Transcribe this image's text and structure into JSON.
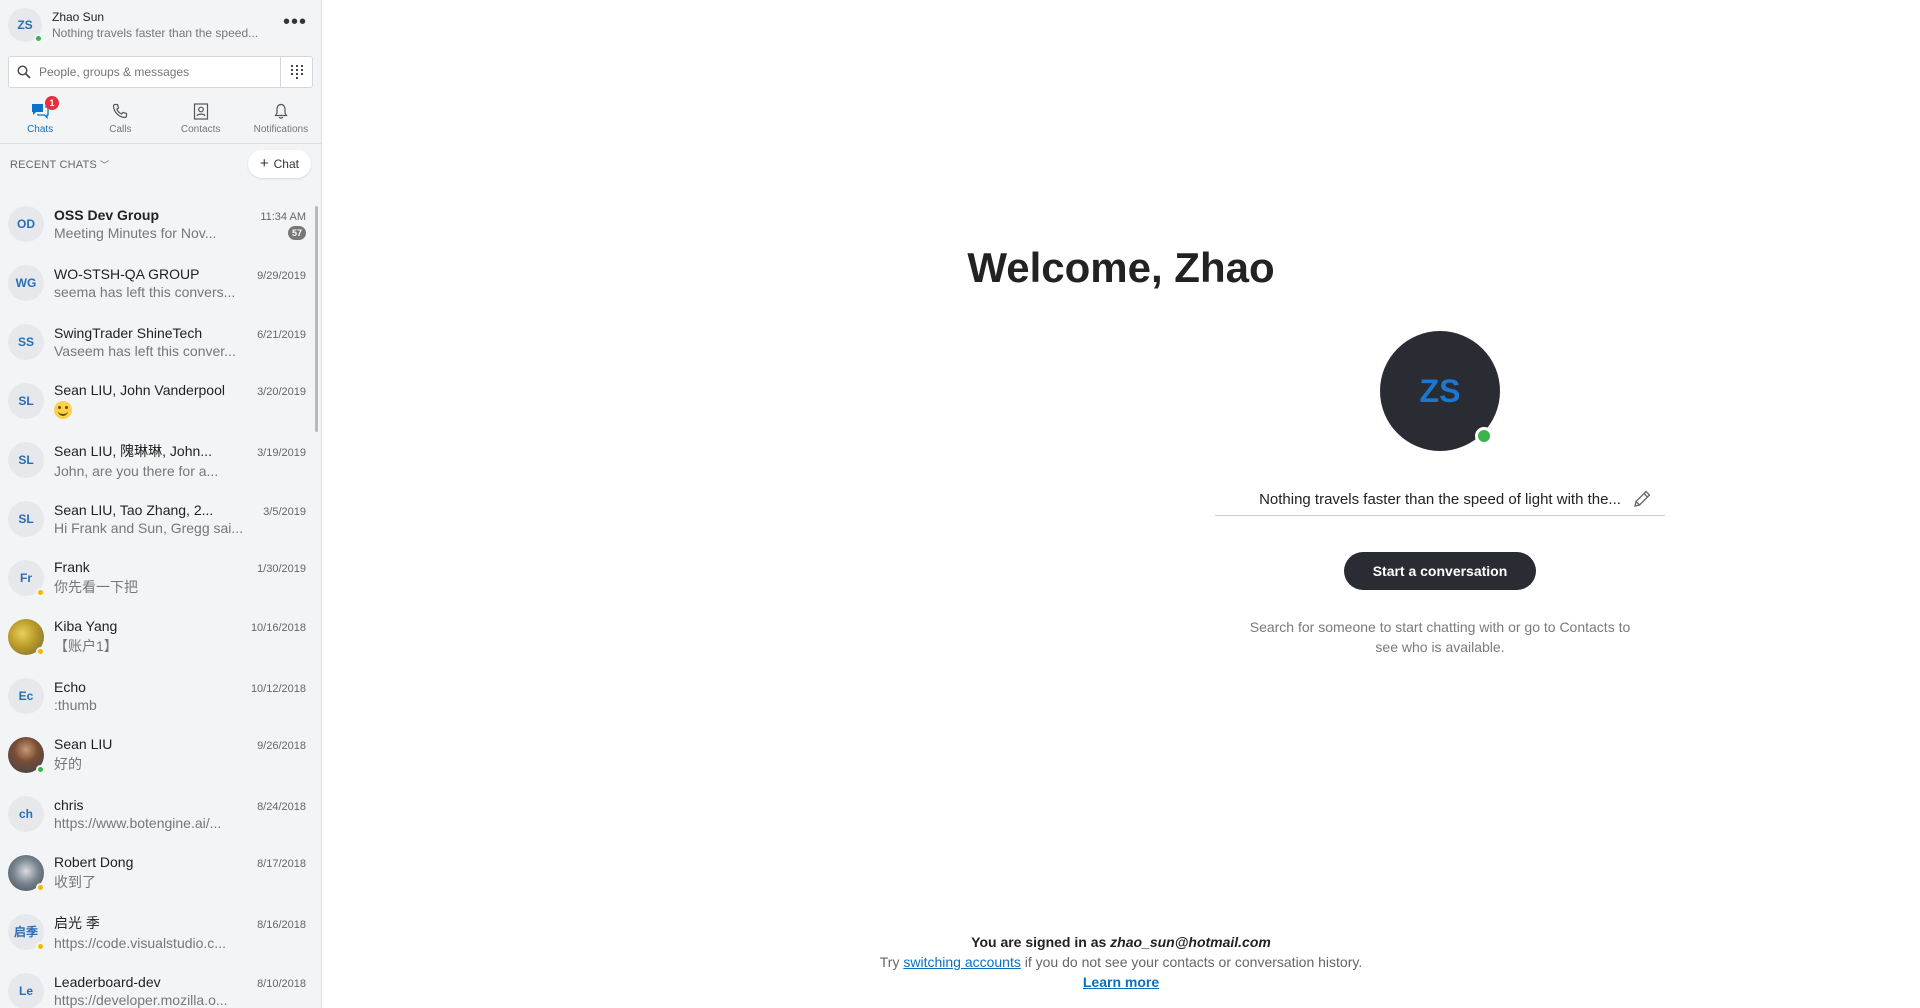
{
  "profile": {
    "initials": "ZS",
    "name": "Zhao Sun",
    "mood": "Nothing travels faster than the speed...",
    "more_label": "•••"
  },
  "search": {
    "placeholder": "People, groups & messages"
  },
  "tabs": [
    {
      "label": "Chats",
      "icon": "chat-icon",
      "active": true,
      "badge": "1"
    },
    {
      "label": "Calls",
      "icon": "phone-icon"
    },
    {
      "label": "Contacts",
      "icon": "contacts-icon"
    },
    {
      "label": "Notifications",
      "icon": "bell-icon"
    }
  ],
  "recent": {
    "title": "RECENT CHATS",
    "chevron": "﹀",
    "new_chat_plus": "+",
    "new_chat_label": "Chat"
  },
  "chats": [
    {
      "initials": "OD",
      "name": "OSS Dev Group",
      "time": "11:34 AM",
      "preview": "Meeting Minutes for Nov...",
      "unread": "57"
    },
    {
      "initials": "WG",
      "name": "WO-STSH-QA GROUP",
      "time": "9/29/2019",
      "preview": "seema has left this convers..."
    },
    {
      "initials": "SS",
      "name": "SwingTrader ShineTech",
      "time": "6/21/2019",
      "preview": "Vaseem has left this conver..."
    },
    {
      "initials": "SL",
      "name": "Sean LIU, John Vanderpool",
      "time": "3/20/2019",
      "preview": ""
    },
    {
      "initials": "SL",
      "name": "Sean LIU, 隗琳琳, John...",
      "time": "3/19/2019",
      "preview": "John, are you there for a..."
    },
    {
      "initials": "SL",
      "name": "Sean LIU, Tao Zhang, 2...",
      "time": "3/5/2019",
      "preview": "Hi Frank and Sun, Gregg sai..."
    },
    {
      "initials": "Fr",
      "name": "Frank",
      "time": "1/30/2019",
      "preview": "你先看一下把",
      "status": "away"
    },
    {
      "initials": "",
      "name": "Kiba Yang",
      "time": "10/16/2018",
      "preview": "【账户1】",
      "status": "away"
    },
    {
      "initials": "Ec",
      "name": "Echo",
      "time": "10/12/2018",
      "preview": ":thumb"
    },
    {
      "initials": "",
      "name": "Sean LIU",
      "time": "9/26/2018",
      "preview": "好的",
      "status": "online"
    },
    {
      "initials": "ch",
      "name": "chris",
      "time": "8/24/2018",
      "preview": "https://www.botengine.ai/..."
    },
    {
      "initials": "",
      "name": "Robert Dong",
      "time": "8/17/2018",
      "preview": "收到了",
      "status": "away"
    },
    {
      "initials": "启季",
      "name": "启光 季",
      "time": "8/16/2018",
      "preview": "https://code.visualstudio.c...",
      "status": "away"
    },
    {
      "initials": "Le",
      "name": "Leaderboard-dev",
      "time": "8/10/2018",
      "preview": "https://developer.mozilla.o..."
    }
  ],
  "main": {
    "welcome": "Welcome, Zhao",
    "avatar_initials": "ZS",
    "mood": "Nothing travels faster than the speed of light with the...",
    "start_button": "Start a conversation",
    "hint": "Search for someone to start chatting with or go to Contacts to see who is available.",
    "signed_prefix": "You are signed in as",
    "email": "zhao_sun@hotmail.com",
    "try_label": "Try",
    "switch_link": "switching accounts",
    "switch_suffix": "if you do not see your contacts or conversation history.",
    "learn_more": "Learn more"
  },
  "colors": {
    "accent": "#0a74c9",
    "dark_button": "#2a2c33",
    "online": "#39b54a",
    "away": "#f5b800",
    "badge": "#e8303c"
  }
}
